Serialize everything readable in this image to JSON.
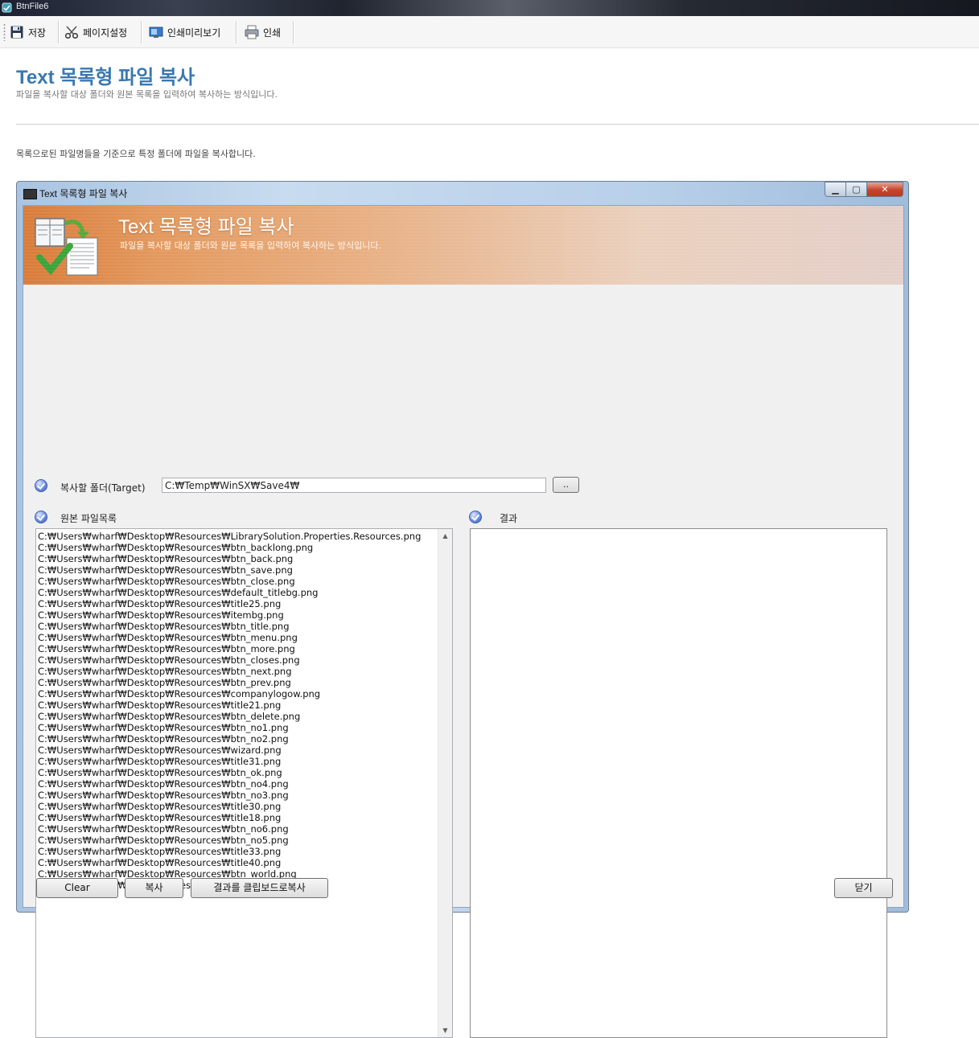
{
  "app": {
    "title": "BtnFile6"
  },
  "toolbar": {
    "save_label": "저장",
    "page_setup_label": "페이지설정",
    "print_preview_label": "인쇄미리보기",
    "print_label": "인쇄"
  },
  "page": {
    "title": "Text 목록형 파일 복사",
    "subtitle": "파일을 복사할 대상 폴더와 원본 목록을 입력하여 복사하는 방식입니다.",
    "description": "목록으로된 파일명들을 기준으로 특정 폴더에 파일을 복사합니다."
  },
  "window": {
    "title": "Text 목록형 파일 복사",
    "banner_title": "Text 목록형 파일 복사",
    "banner_subtitle": "파일을 복사할 대상 폴더와 원본 목록을 입력하여 복사하는 방식입니다.",
    "target_label": "복사할 폴더(Target)",
    "target_value": "C:₩Temp₩WinSX₩Save4₩",
    "browse_label": "..",
    "source_label": "원본 파일목록",
    "result_label": "결과",
    "source_files": [
      "C:₩Users₩wharf₩Desktop₩Resources₩LibrarySolution.Properties.Resources.png",
      "C:₩Users₩wharf₩Desktop₩Resources₩btn_backlong.png",
      "C:₩Users₩wharf₩Desktop₩Resources₩btn_back.png",
      "C:₩Users₩wharf₩Desktop₩Resources₩btn_save.png",
      "C:₩Users₩wharf₩Desktop₩Resources₩btn_close.png",
      "C:₩Users₩wharf₩Desktop₩Resources₩default_titlebg.png",
      "C:₩Users₩wharf₩Desktop₩Resources₩title25.png",
      "C:₩Users₩wharf₩Desktop₩Resources₩itembg.png",
      "C:₩Users₩wharf₩Desktop₩Resources₩btn_title.png",
      "C:₩Users₩wharf₩Desktop₩Resources₩btn_menu.png",
      "C:₩Users₩wharf₩Desktop₩Resources₩btn_more.png",
      "C:₩Users₩wharf₩Desktop₩Resources₩btn_closes.png",
      "C:₩Users₩wharf₩Desktop₩Resources₩btn_next.png",
      "C:₩Users₩wharf₩Desktop₩Resources₩btn_prev.png",
      "C:₩Users₩wharf₩Desktop₩Resources₩companylogow.png",
      "C:₩Users₩wharf₩Desktop₩Resources₩title21.png",
      "C:₩Users₩wharf₩Desktop₩Resources₩btn_delete.png",
      "C:₩Users₩wharf₩Desktop₩Resources₩btn_no1.png",
      "C:₩Users₩wharf₩Desktop₩Resources₩btn_no2.png",
      "C:₩Users₩wharf₩Desktop₩Resources₩wizard.png",
      "C:₩Users₩wharf₩Desktop₩Resources₩title31.png",
      "C:₩Users₩wharf₩Desktop₩Resources₩btn_ok.png",
      "C:₩Users₩wharf₩Desktop₩Resources₩btn_no4.png",
      "C:₩Users₩wharf₩Desktop₩Resources₩btn_no3.png",
      "C:₩Users₩wharf₩Desktop₩Resources₩title30.png",
      "C:₩Users₩wharf₩Desktop₩Resources₩title18.png",
      "C:₩Users₩wharf₩Desktop₩Resources₩btn_no6.png",
      "C:₩Users₩wharf₩Desktop₩Resources₩btn_no5.png",
      "C:₩Users₩wharf₩Desktop₩Resources₩title33.png",
      "C:₩Users₩wharf₩Desktop₩Resources₩title40.png",
      "C:₩Users₩wharf₩Desktop₩Resources₩btn_world.png",
      "C:₩Users₩wharf₩Desktop₩Resources₩title44.png"
    ],
    "buttons": {
      "clear": "Clear",
      "copy": "복사",
      "copy_result": "결과를 클립보드로복사",
      "close": "닫기"
    }
  },
  "colors": {
    "title_blue": "#3a78b0",
    "banner_orange": "#d97c3a",
    "window_frame": "#b9d0ea"
  },
  "icons": {
    "save": "floppy-disk-icon",
    "page_setup": "scissors-icon",
    "print_preview": "monitor-icon",
    "print": "printer-icon",
    "check": "check-circle-icon",
    "banner": "file-copy-check-icon"
  }
}
